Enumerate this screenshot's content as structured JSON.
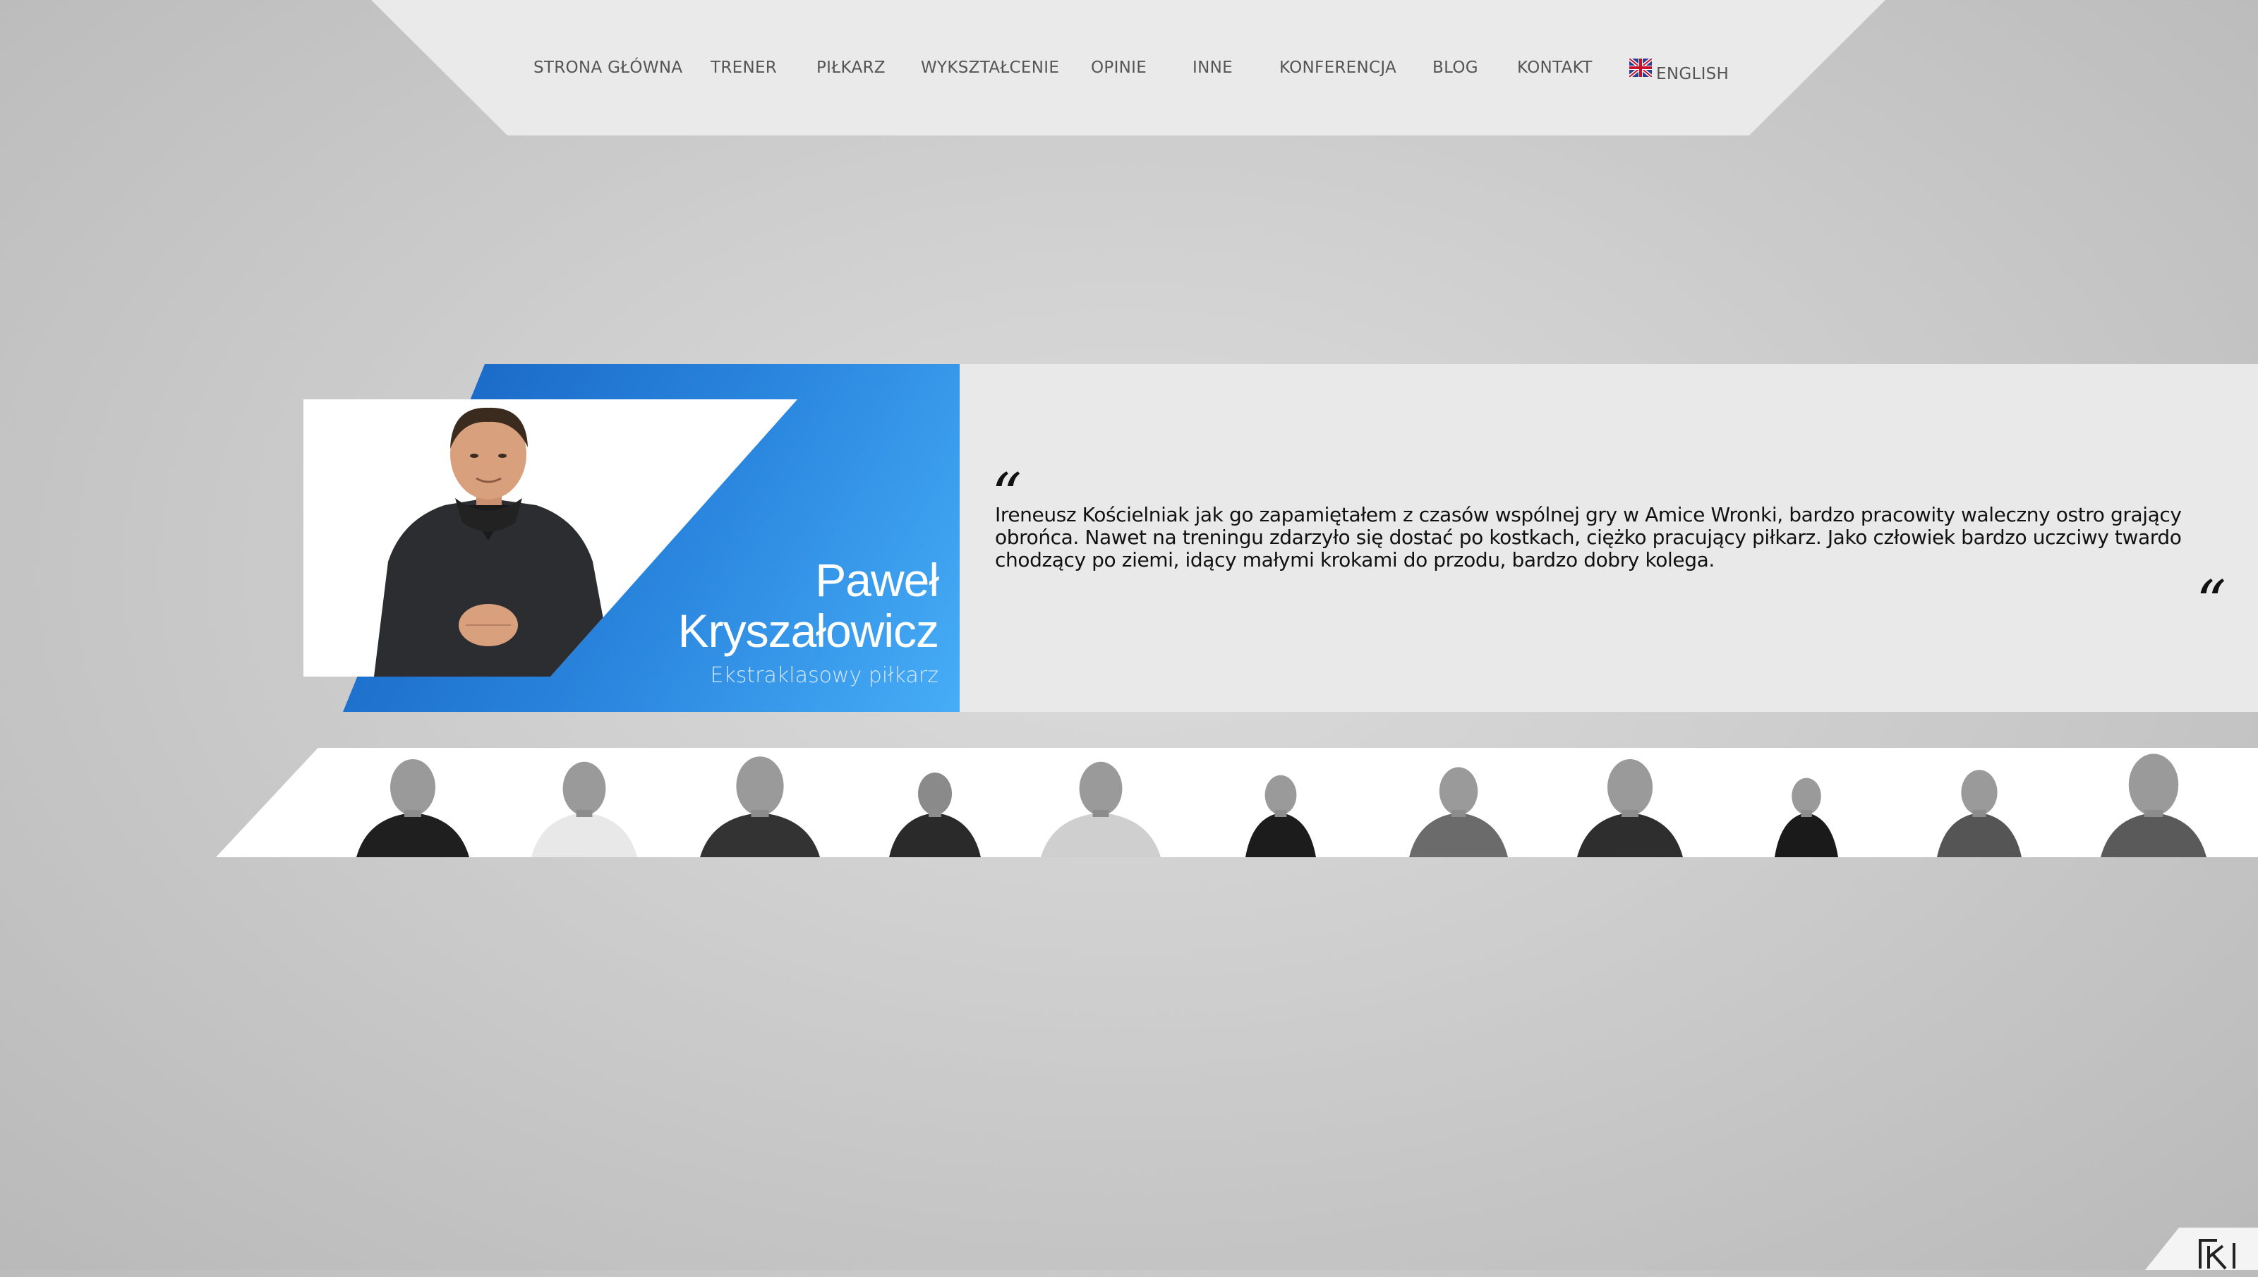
{
  "nav": {
    "items": [
      {
        "label": "STRONA GŁÓWNA"
      },
      {
        "label": "TRENER"
      },
      {
        "label": "PIŁKARZ"
      },
      {
        "label": "WYKSZTAŁCENIE"
      },
      {
        "label": "OPINIE"
      },
      {
        "label": "INNE"
      },
      {
        "label": "KONFERENCJA"
      },
      {
        "label": "BLOG"
      },
      {
        "label": "KONTAKT"
      },
      {
        "label": "ENGLISH",
        "icon": "uk-flag-icon"
      }
    ]
  },
  "testimonial": {
    "first_name": "Paweł",
    "last_name": "Kryszałowicz",
    "role": "Ekstraklasowy piłkarz",
    "open_quote": "“",
    "close_quote": "“",
    "text": "Ireneusz Kościelniak jak go zapamiętałem z czasów wspólnej gry w Amice Wronki, bardzo pracowity waleczny ostro grający obrońca. Nawet na treningu zdarzyło się dostać po kostkach, ciężko pracujący piłkarz. Jako człowiek bardzo uczciwy twardo chodzący po ziemi, idący małymi krokami do przodu, bardzo dobry kolega."
  },
  "thumbnails": {
    "count": 11,
    "selected": 4
  },
  "colors": {
    "accent_blue": "#2a86de",
    "nav_bg": "#eaeaea",
    "panel_bg": "#e9e9e9"
  },
  "logo": {
    "text": "IK"
  }
}
